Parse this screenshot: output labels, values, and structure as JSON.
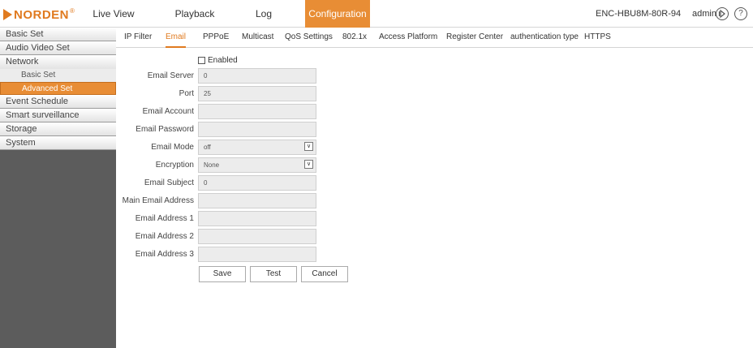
{
  "header": {
    "brand": "NORDEN",
    "brand_mark": "®",
    "brand_color": "#e07a1f",
    "nav": [
      "Live View",
      "Playback",
      "Log",
      "Configuration"
    ],
    "active_nav": "Configuration",
    "device_name": "ENC-HBU8M-80R-94",
    "user": "admin",
    "icons": {
      "logout": "logout-icon",
      "help": "help-icon"
    }
  },
  "sidebar": {
    "items": [
      {
        "label": "Basic Set"
      },
      {
        "label": "Audio Video Set"
      },
      {
        "label": "Network",
        "children": [
          "Basic Set",
          "Advanced Set"
        ],
        "active_child": "Advanced Set"
      },
      {
        "label": "Event Schedule"
      },
      {
        "label": "Smart surveillance"
      },
      {
        "label": "Storage"
      },
      {
        "label": "System"
      }
    ]
  },
  "subtabs": {
    "items": [
      "IP Filter",
      "Email",
      "PPPoE",
      "Multicast",
      "QoS Settings",
      "802.1x",
      "Access Platform",
      "Register Center",
      "authentication type",
      "HTTPS"
    ],
    "active": "Email"
  },
  "form": {
    "enabled_label": "Enabled",
    "enabled_checked": false,
    "fields": [
      {
        "label": "Email Server",
        "value": "0",
        "type": "text"
      },
      {
        "label": "Port",
        "value": "25",
        "type": "text"
      },
      {
        "label": "Email Account",
        "value": "",
        "type": "text"
      },
      {
        "label": "Email Password",
        "value": "",
        "type": "password"
      },
      {
        "label": "Email Mode",
        "value": "off",
        "type": "select"
      },
      {
        "label": "Encryption",
        "value": "None",
        "type": "select"
      },
      {
        "label": "Email Subject",
        "value": "0",
        "type": "text"
      },
      {
        "label": "Main Email Address",
        "value": "",
        "type": "text"
      },
      {
        "label": "Email Address 1",
        "value": "",
        "type": "text"
      },
      {
        "label": "Email Address 2",
        "value": "",
        "type": "text"
      },
      {
        "label": "Email Address 3",
        "value": "",
        "type": "text"
      }
    ],
    "buttons": {
      "save": "Save",
      "test": "Test",
      "cancel": "Cancel"
    }
  },
  "colors": {
    "accent": "#e88d35",
    "sidebar_bg": "#5c5c5c"
  }
}
